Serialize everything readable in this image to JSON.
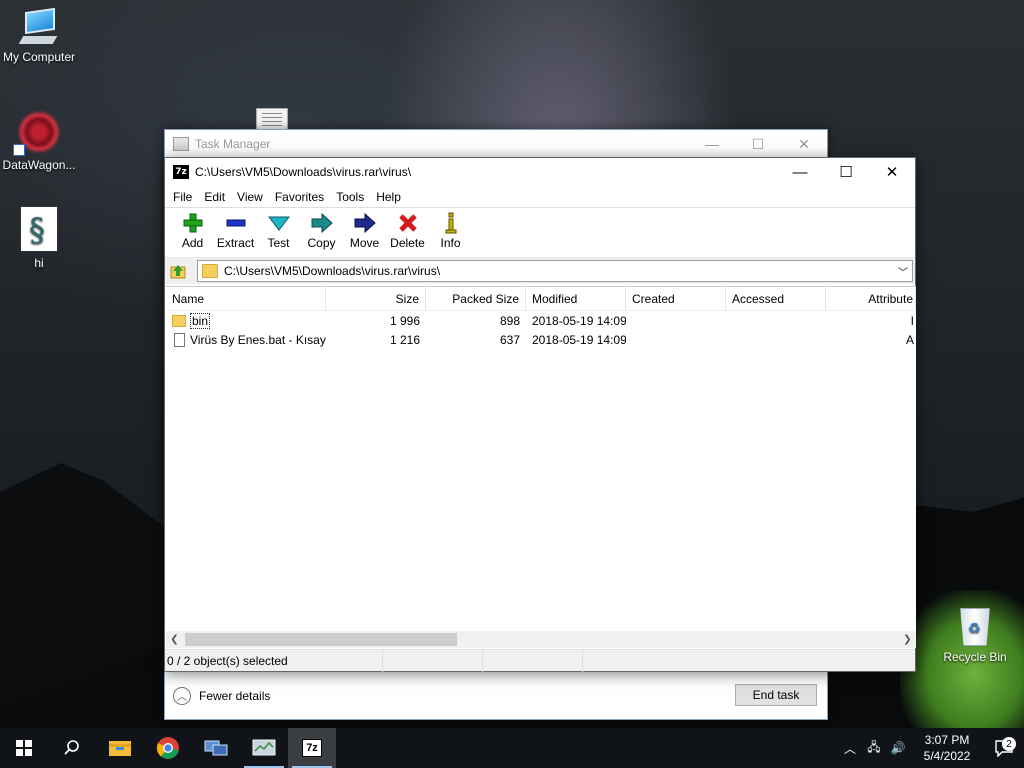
{
  "desktop": {
    "icons": [
      {
        "label": "My Computer",
        "icon": "computer-icon"
      },
      {
        "label": "DataWagon...",
        "icon": "datawagon-icon"
      },
      {
        "label": "hi",
        "icon": "script-file-icon"
      },
      {
        "label": "Recycle Bin",
        "icon": "recycle-bin-icon"
      }
    ]
  },
  "task_manager": {
    "title": "Task Manager",
    "fewer_details": "Fewer details",
    "end_task": "End task"
  },
  "sevenzip": {
    "title": "C:\\Users\\VM5\\Downloads\\virus.rar\\virus\\",
    "menu": [
      "File",
      "Edit",
      "View",
      "Favorites",
      "Tools",
      "Help"
    ],
    "toolbar": [
      {
        "label": "Add",
        "icon": "add-icon",
        "color": "#1aa81a"
      },
      {
        "label": "Extract",
        "icon": "extract-icon",
        "color": "#1d32c8"
      },
      {
        "label": "Test",
        "icon": "test-icon",
        "color": "#1fb5c8"
      },
      {
        "label": "Copy",
        "icon": "copy-icon",
        "color": "#1b8a8a"
      },
      {
        "label": "Move",
        "icon": "move-icon",
        "color": "#1c2a8c"
      },
      {
        "label": "Delete",
        "icon": "delete-icon",
        "color": "#d21e1e"
      },
      {
        "label": "Info",
        "icon": "info-icon",
        "color": "#c8b400"
      }
    ],
    "path": "C:\\Users\\VM5\\Downloads\\virus.rar\\virus\\",
    "columns": [
      "Name",
      "Size",
      "Packed Size",
      "Modified",
      "Created",
      "Accessed",
      "Attribute"
    ],
    "rows": [
      {
        "name": "bin",
        "size": "1 996",
        "packed": "898",
        "modified": "2018-05-19 14:09",
        "created": "",
        "accessed": "",
        "attr": "I",
        "type": "folder"
      },
      {
        "name": "Virüs By Enes.bat - Kısay...",
        "size": "1 216",
        "packed": "637",
        "modified": "2018-05-19 14:09",
        "created": "",
        "accessed": "",
        "attr": "A",
        "type": "file"
      }
    ],
    "status": "0 / 2 object(s) selected"
  },
  "taskbar": {
    "clock_time": "3:07 PM",
    "clock_date": "5/4/2022",
    "notification_count": "2",
    "apps": [
      "start-icon",
      "search-icon",
      "file-explorer-icon",
      "chrome-icon",
      "network-app-icon",
      "task-manager-icon",
      "7zip-icon"
    ],
    "z7_label": "7z"
  }
}
